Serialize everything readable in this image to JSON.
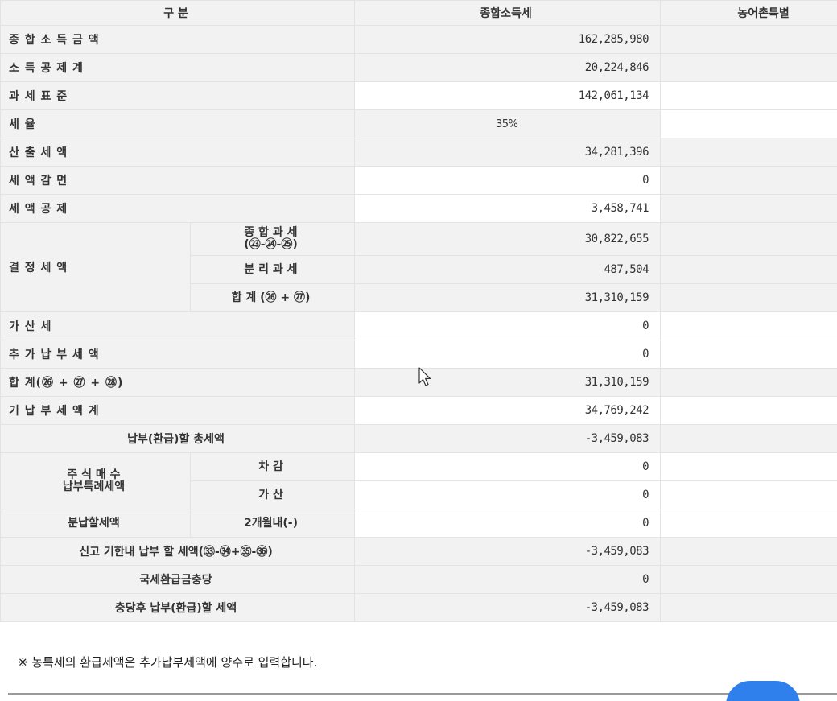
{
  "header": {
    "col_category": "구 분",
    "col_income_tax": "종합소득세",
    "col_rural_tax": "농어촌특별"
  },
  "rows": {
    "total_income": {
      "label": "종 합 소 득 금 액",
      "value": "162,285,980"
    },
    "income_deduction": {
      "label": "소 득 공 제 계",
      "value": "20,224,846"
    },
    "tax_base": {
      "label": "과 세 표 준",
      "value": "142,061,134"
    },
    "tax_rate": {
      "label": "세 율",
      "value": "35%"
    },
    "calculated_tax": {
      "label": "산 출 세 액",
      "value": "34,281,396"
    },
    "tax_reduction": {
      "label": "세 액 감 면",
      "value": "0"
    },
    "tax_credit": {
      "label": "세 액 공 제",
      "value": "3,458,741"
    },
    "determined_tax": {
      "label": "결 정 세 액",
      "comprehensive_label_1": "종 합 과 세",
      "comprehensive_label_2": "(㉓-㉔-㉕)",
      "comprehensive_value": "30,822,655",
      "separate_label": "분 리 과 세",
      "separate_value": "487,504",
      "sum_label": "합 계 (㉖ + ㉗)",
      "sum_value": "31,310,159"
    },
    "penalty_tax": {
      "label": "가 산 세",
      "value": "0"
    },
    "additional_payment": {
      "label": "추 가 납 부 세 액",
      "value": "0"
    },
    "subtotal": {
      "label": "합 계(㉖ + ㉗ + ㉘)",
      "value": "31,310,159"
    },
    "prepaid_total": {
      "label": "기 납 부 세 액 계",
      "value": "34,769,242"
    },
    "total_payable": {
      "label": "납부(환급)할 총세액",
      "value": "-3,459,083"
    },
    "stock_special": {
      "label_1": "주 식 매 수",
      "label_2": "납부특례세액",
      "deduct_label": "차 감",
      "deduct_value": "0",
      "add_label": "가 산",
      "add_value": "0"
    },
    "installment": {
      "label": "분납할세액",
      "sub_label": "2개월내(-)",
      "value": "0"
    },
    "within_deadline": {
      "label": "신고 기한내 납부 할 세액(㉝-㉞+㉟-㊱)",
      "value": "-3,459,083"
    },
    "refund_offset": {
      "label": "국세환급금충당",
      "value": "0"
    },
    "after_offset": {
      "label": "충당후 납부(환급)할 세액",
      "value": "-3,459,083"
    }
  },
  "footer_note": "※ 농특세의 환급세액은 추가납부세액에 양수로 입력합니다.",
  "colors": {
    "header_bg": "#f2f2f2",
    "border": "#e3e3e3",
    "chat_bubble": "#2f80ed"
  }
}
